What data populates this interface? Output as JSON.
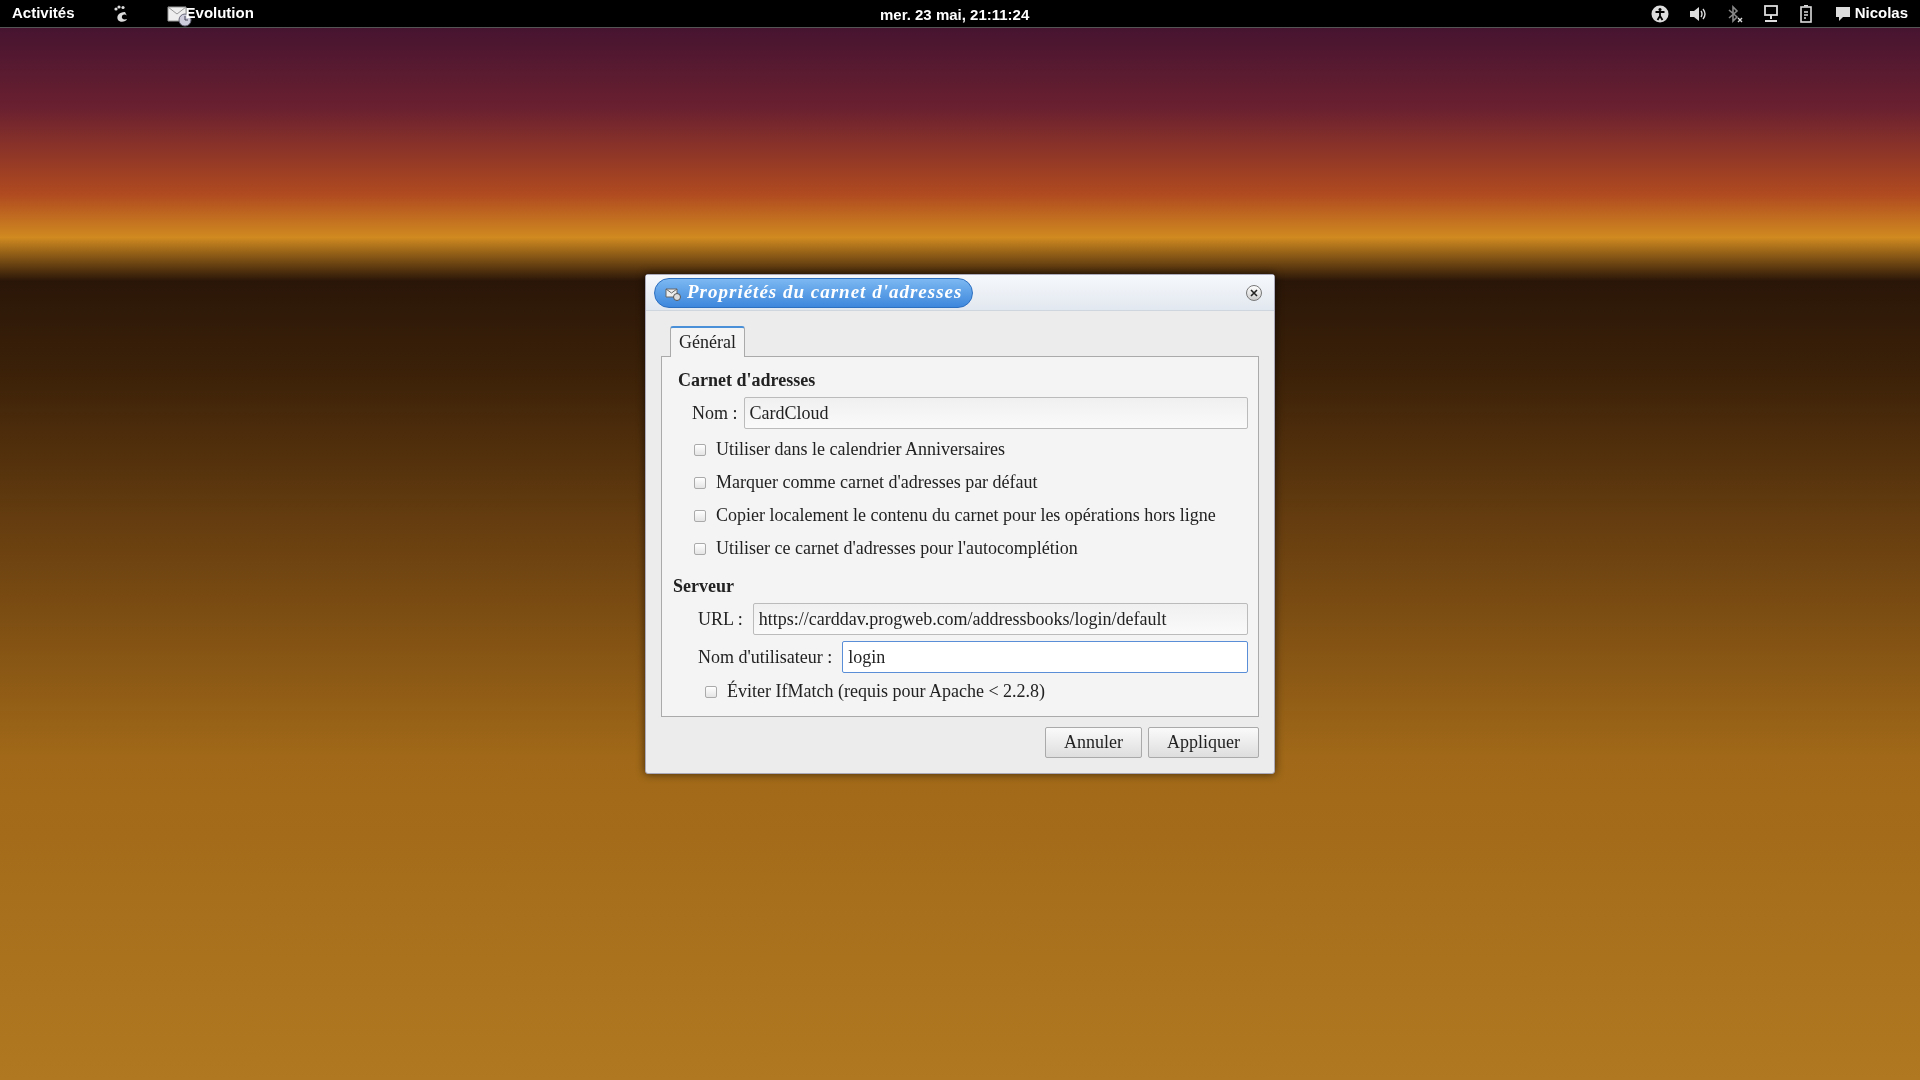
{
  "top_bar": {
    "activities": "Activités",
    "app_name": "Evolution",
    "clock": "mer. 23 mai, 21:11:24",
    "user": "Nicolas"
  },
  "dialog": {
    "title": "Propriétés du carnet d'adresses",
    "tabs": [
      {
        "label": "Général",
        "selected": true
      }
    ],
    "address_book": {
      "heading": "Carnet d'adresses",
      "name_field": {
        "label": "Nom :",
        "value": "CardCloud",
        "focused": false
      },
      "options": [
        {
          "label": "Utiliser dans le calendrier Anniversaires",
          "checked": false
        },
        {
          "label": "Marquer comme carnet d'adresses par défaut",
          "checked": false
        },
        {
          "label": "Copier localement le contenu du carnet pour les opérations hors ligne",
          "checked": false
        },
        {
          "label": "Utiliser ce carnet d'adresses pour l'autocomplétion",
          "checked": false
        }
      ]
    },
    "server": {
      "heading": "Serveur",
      "url_field": {
        "label": "URL :",
        "value": "https://carddav.progweb.com/addressbooks/login/default",
        "focused": false
      },
      "username_field": {
        "label": "Nom d'utilisateur :",
        "value": "login",
        "focused": true
      },
      "options": [
        {
          "label": "Éviter IfMatch (requis pour Apache < 2.2.8)",
          "checked": false
        }
      ]
    },
    "buttons": [
      "Annuler",
      "Appliquer"
    ]
  }
}
